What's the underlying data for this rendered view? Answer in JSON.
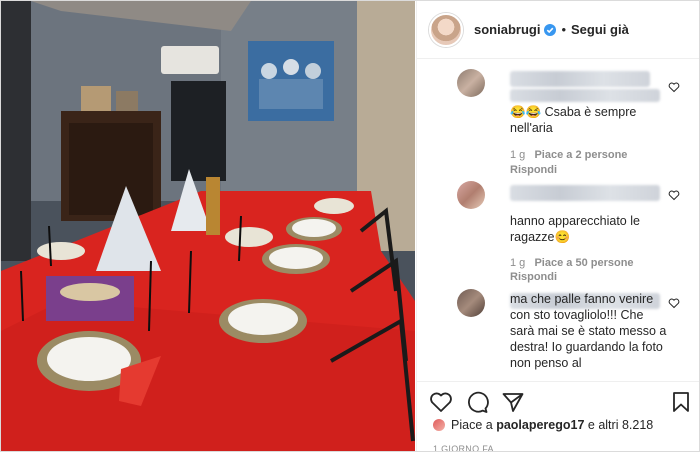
{
  "header": {
    "username": "soniabrugi",
    "follow_label": "Segui già",
    "separator": "•"
  },
  "comments": [
    {
      "text": "Csaba è sempre nell'aria",
      "time": "1 g",
      "likes": "Piace a 2 persone",
      "reply": "Rispondi"
    },
    {
      "text": "hanno apparecchiato le ragazze",
      "time": "1 g",
      "likes": "Piace a 50 persone",
      "reply": "Rispondi"
    },
    {
      "text": "ma che palle fanno venire con sto tovagliolo!!! Che sarà mai se è stato messo a destra! Io guardando la foto non penso al"
    }
  ],
  "icons": {
    "heart": "heart-icon",
    "comment": "comment-icon",
    "share": "share-icon",
    "bookmark": "bookmark-icon",
    "verified": "verified-badge-icon"
  },
  "likes": {
    "prefix": "Piace a",
    "user": "paolaperego17",
    "suffix": "e altri 8.218"
  },
  "timestamp": "1 GIORNO FA",
  "colors": {
    "verified": "#3897f0",
    "tablecloth": "#d9241f",
    "text": "#262626",
    "muted": "#8e8e8e"
  }
}
